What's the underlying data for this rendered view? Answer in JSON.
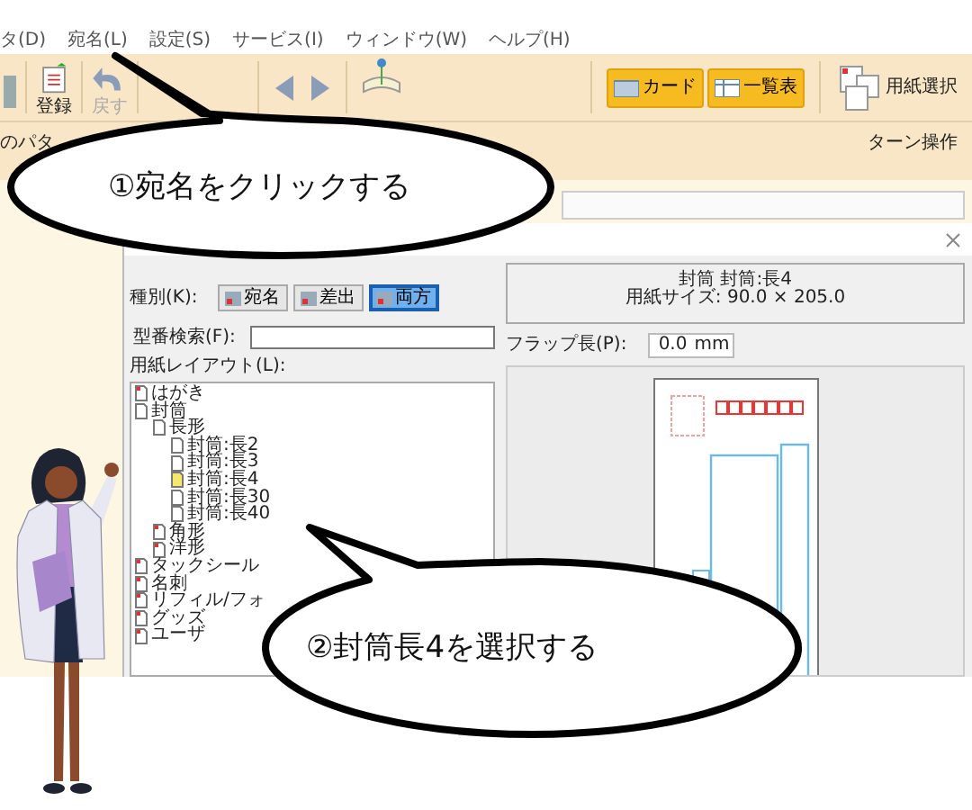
{
  "menu": [
    {
      "label": "タ(D)"
    },
    {
      "label": "宛名(L)"
    },
    {
      "label": "設定(S)"
    },
    {
      "label": "サービス(I)"
    },
    {
      "label": "ウィンドウ(W)"
    },
    {
      "label": "ヘルプ(H)"
    }
  ],
  "toolbar": {
    "buttons": [
      {
        "label": "登録",
        "disabled": false
      },
      {
        "label": "戻す",
        "disabled": true
      }
    ],
    "view_buttons": [
      {
        "label": "カード"
      },
      {
        "label": "一覧表"
      }
    ],
    "paper_button": "用紙選択"
  },
  "subtoolbar": [
    "のパタ",
    "ターン操作"
  ],
  "dialog": {
    "type_label": "種別(K):",
    "types": [
      {
        "label": "宛名",
        "selected": false
      },
      {
        "label": "差出",
        "selected": false
      },
      {
        "label": "両方",
        "selected": true
      }
    ],
    "search_label": "型番検索(F):",
    "layout_label": "用紙レイアウト(L):",
    "tree": [
      {
        "label": "はがき",
        "selected": false
      },
      {
        "label": "封筒",
        "selected": false,
        "children": [
          {
            "label": "長形",
            "selected": false,
            "children": [
              {
                "label": "封筒:長2",
                "selected": false
              },
              {
                "label": "封筒:長3",
                "selected": false
              },
              {
                "label": "封筒:長4",
                "selected": true
              },
              {
                "label": "封筒:長30",
                "selected": false
              },
              {
                "label": "封筒:長40",
                "selected": false
              }
            ]
          },
          {
            "label": "角形",
            "selected": false
          },
          {
            "label": "洋形",
            "selected": false
          }
        ]
      },
      {
        "label": "タックシール",
        "selected": false
      },
      {
        "label": "名刺",
        "selected": false
      },
      {
        "label": "リフィル/フォ",
        "selected": false
      },
      {
        "label": "グッズ",
        "selected": false
      },
      {
        "label": "ユーザ",
        "selected": false
      }
    ],
    "info": [
      "封筒 封筒:長4",
      "用紙サイズ: 90.0 × 205.0"
    ],
    "flap_label": "フラップ長(P):",
    "flap_value": "0.0",
    "flap_unit": "mm"
  },
  "callouts": [
    {
      "text": "①宛名をクリックする"
    },
    {
      "text": "②封筒長4を選択する"
    }
  ]
}
